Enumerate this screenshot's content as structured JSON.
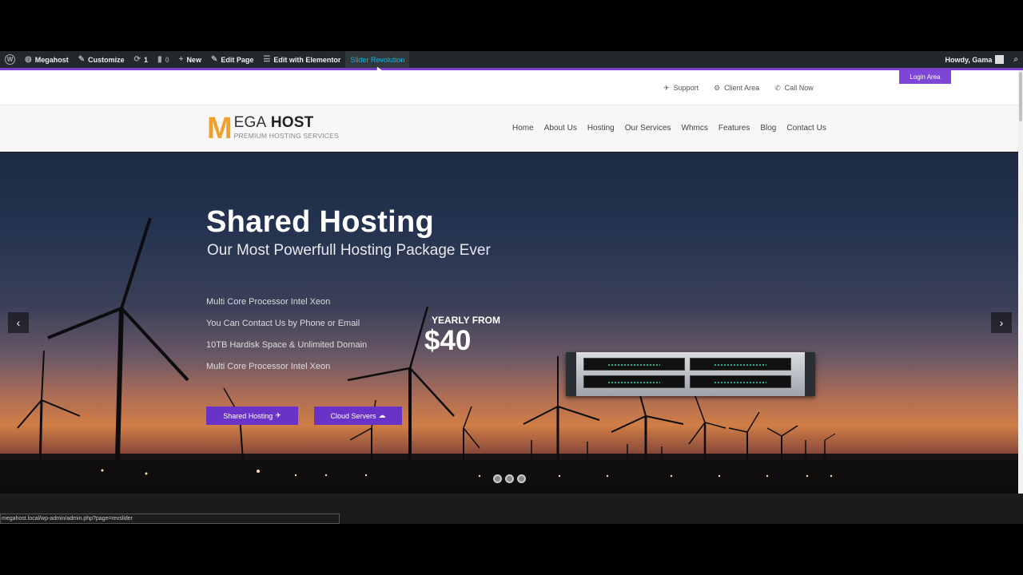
{
  "adminbar": {
    "site": "Megahost",
    "customize": "Customize",
    "updates": "1",
    "comments": "0",
    "new": "New",
    "edit_page": "Edit Page",
    "edit_elementor": "Edit with Elementor",
    "slider_revolution": "Slider Revolution",
    "howdy": "Howdy, Gama"
  },
  "topbar": {
    "links": [
      "Support",
      "Client Area",
      "Call Now"
    ],
    "login": "Login Area"
  },
  "logo": {
    "letter": "M",
    "name_rest": "EGA",
    "name_bold": " HOST",
    "tagline": "PREMIUM HOSTING SERVICES"
  },
  "nav": [
    "Home",
    "About Us",
    "Hosting",
    "Our Services",
    "Whmcs",
    "Features",
    "Blog",
    "Contact Us"
  ],
  "hero": {
    "title": "Shared Hosting",
    "subtitle": "Our Most Powerfull Hosting Package Ever",
    "features": [
      "Multi Core Processor Intel Xeon",
      "You Can Contact Us by Phone or Email",
      "10TB Hardisk Space & Unlimited Domain",
      "Multi Core Processor Intel Xeon"
    ],
    "yearly_label": "YEARLY FROM",
    "price": "$40",
    "button_shared": "Shared Hosting",
    "button_cloud": "Cloud Servers"
  },
  "status_url": "megahost.local/wp-admin/admin.php?page=revslider",
  "icons": {
    "wordpress": "wordpress-logo-icon",
    "prev": "chevron-left-icon",
    "next": "chevron-right-icon"
  }
}
